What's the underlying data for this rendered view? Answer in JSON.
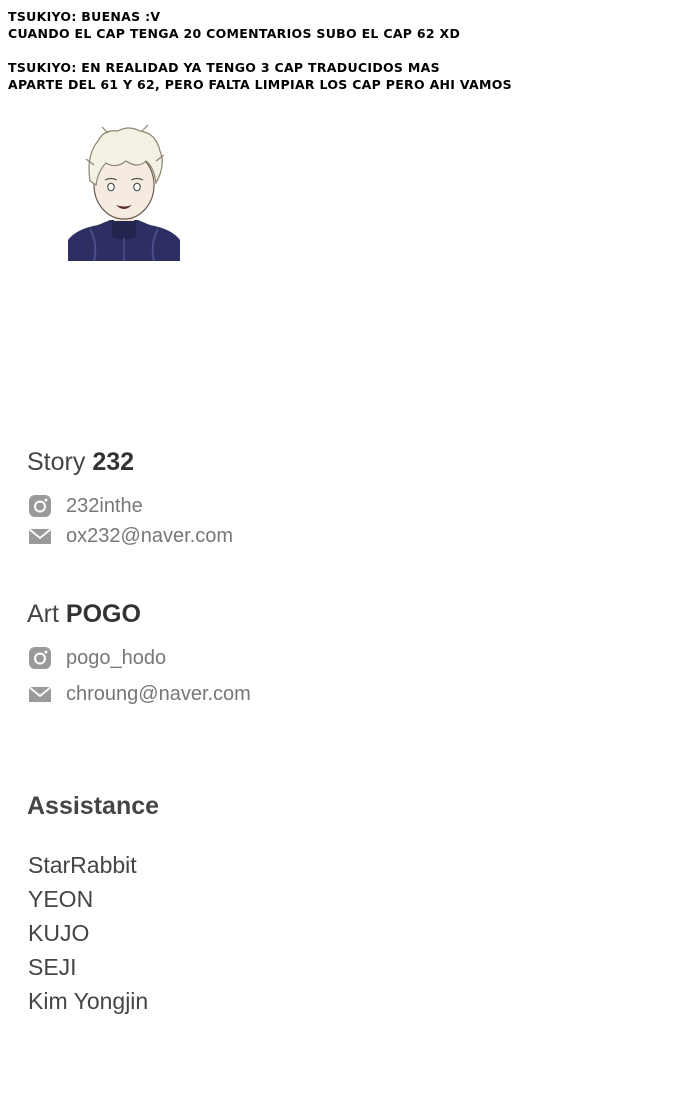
{
  "note": {
    "line1": "TSUKIYO: BUENAS :V",
    "line2": "CUANDO EL CAP TENGA 20 COMENTARIOS SUBO EL CAP 62 XD",
    "line3": "TSUKIYO: EN REALIDAD YA TENGO 3 CAP TRADUCIDOS MAS",
    "line4": "APARTE DEL 61 Y 62, PERO FALTA LIMPIAR LOS CAP PERO AHI VAMOS"
  },
  "story": {
    "role": "Story",
    "name": "232",
    "instagram": "232inthe",
    "email": "ox232@naver.com"
  },
  "art": {
    "role": "Art",
    "name": "POGO",
    "instagram": "pogo_hodo",
    "email": "chroung@naver.com"
  },
  "assistance": {
    "title": "Assistance",
    "members": [
      "StarRabbit",
      "YEON",
      "KUJO",
      "SEJI",
      "Kim Yongjin"
    ]
  },
  "icons": {
    "instagram": "instagram-icon",
    "email": "mail-icon"
  }
}
